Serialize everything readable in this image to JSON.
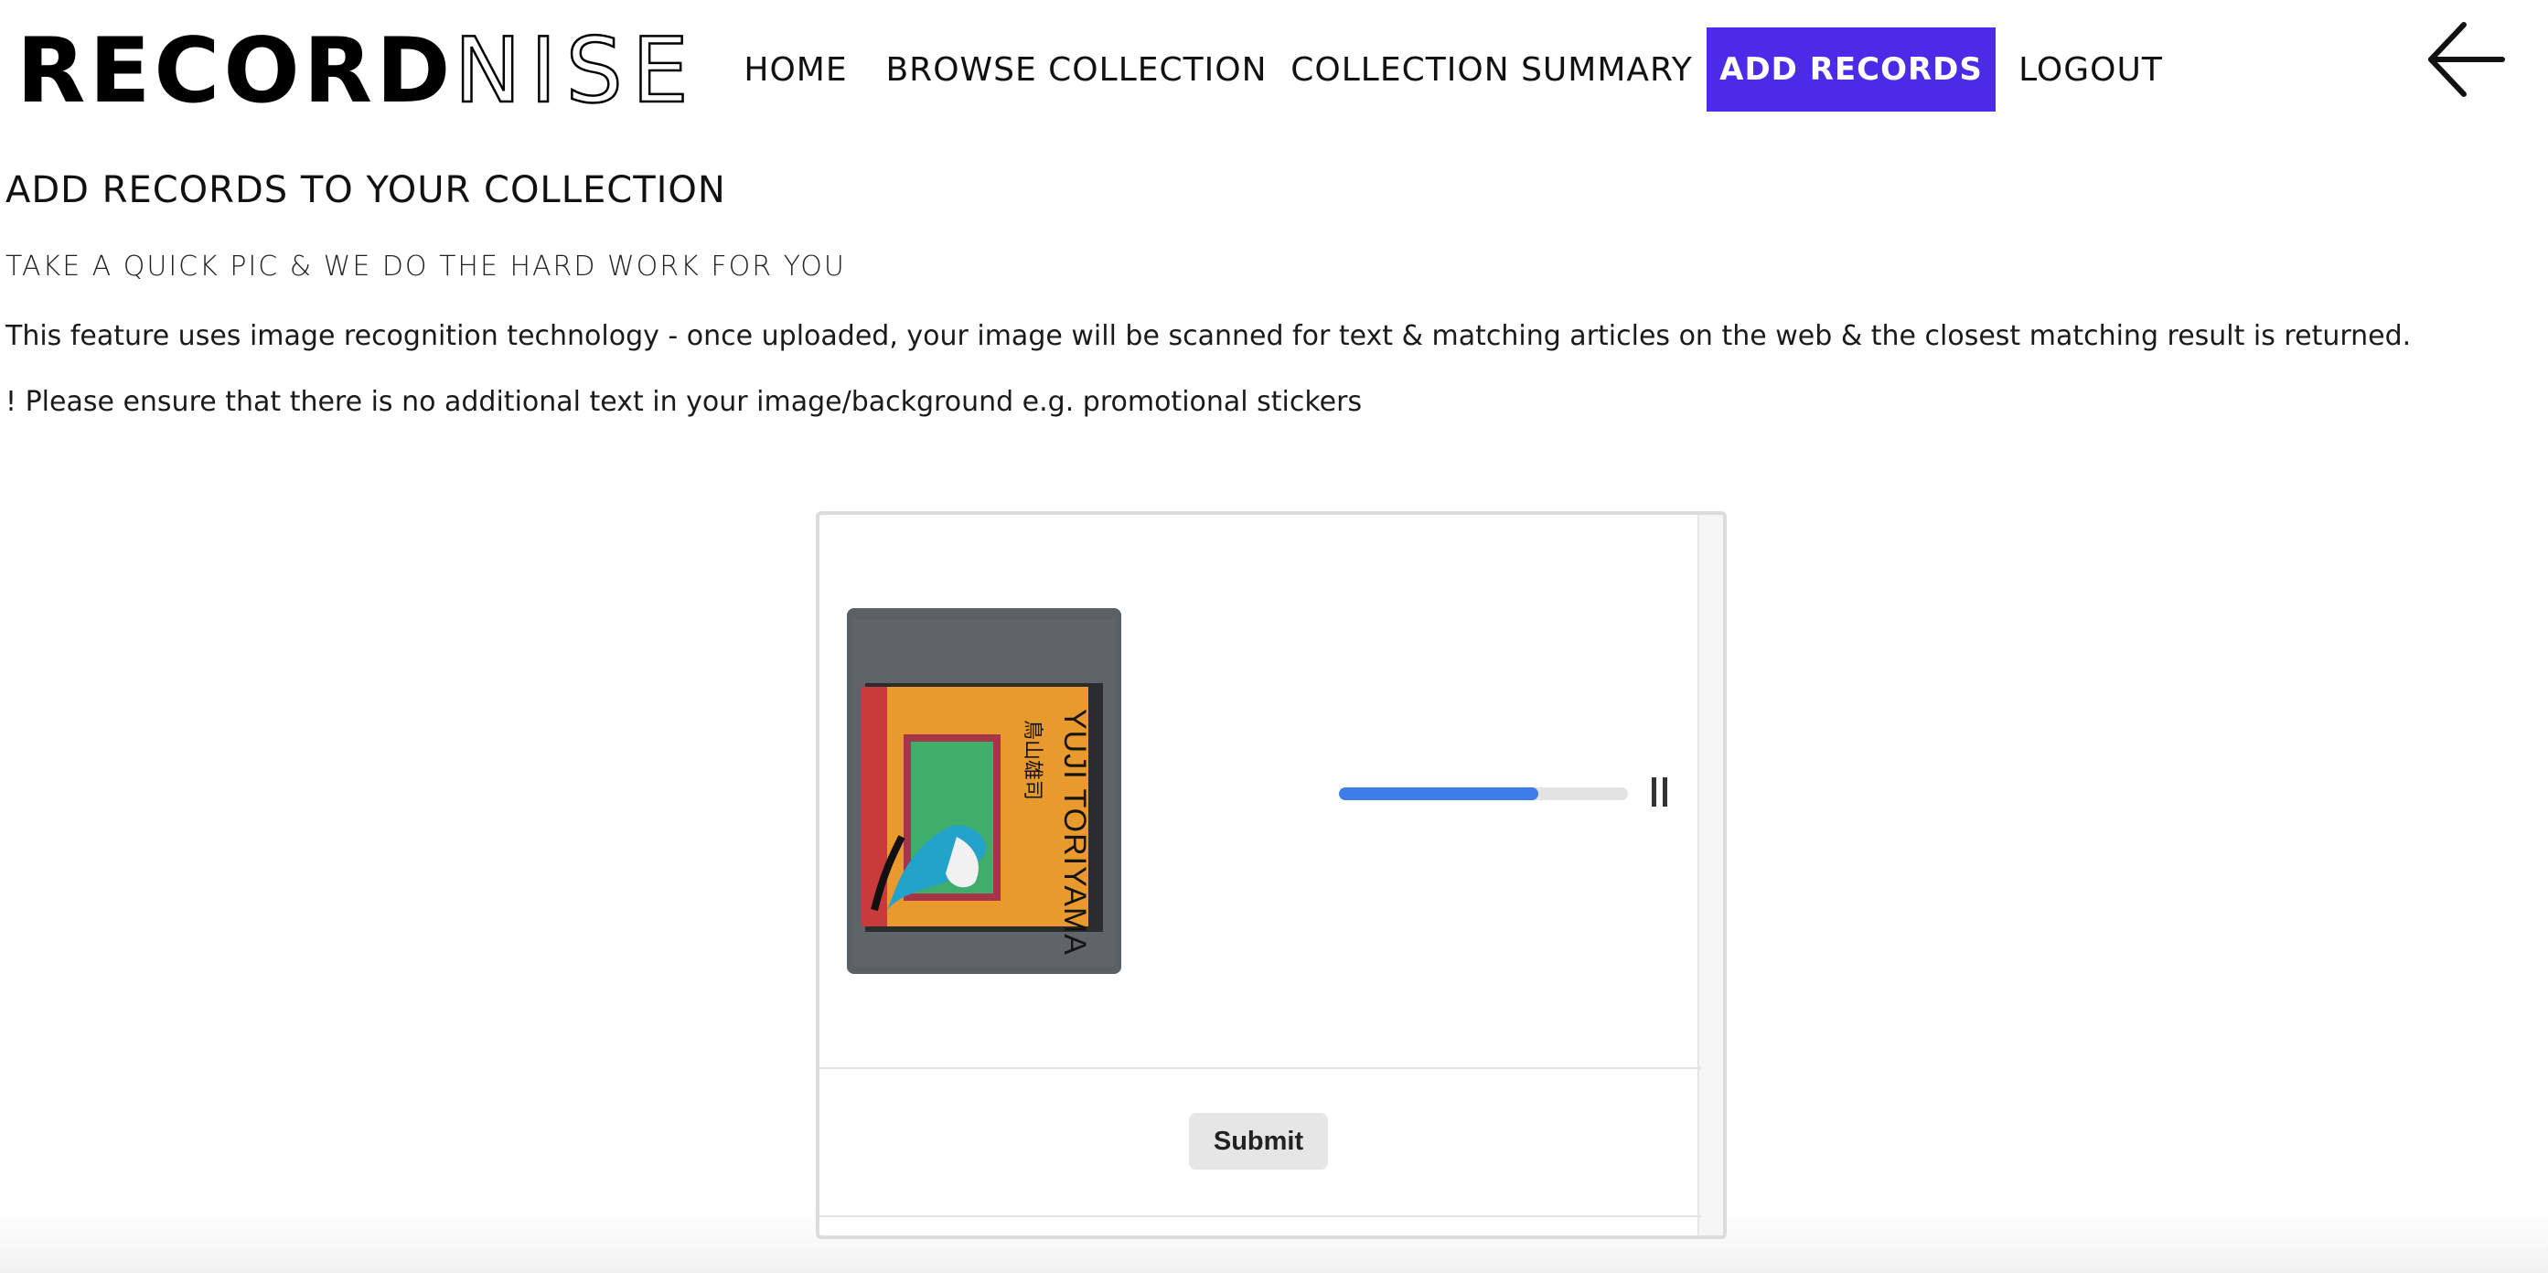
{
  "brand": {
    "logo_bold": "RECORD",
    "logo_light": "NISE"
  },
  "nav": {
    "items": [
      {
        "label": "HOME"
      },
      {
        "label": "BROWSE COLLECTION"
      },
      {
        "label": "COLLECTION SUMMARY"
      },
      {
        "label": "ADD RECORDS",
        "active": true
      },
      {
        "label": "LOGOUT"
      }
    ],
    "active_color": "#4b2be8",
    "back_icon": "arrow-left-icon"
  },
  "page": {
    "title": "ADD RECORDS TO YOUR COLLECTION",
    "subtitle": "TAKE A QUICK PIC & WE DO THE HARD WORK FOR YOU",
    "description": "This feature uses image recognition technology - once uploaded, your image will be scanned for text & matching articles on the web & the closest matching result is returned.",
    "warning": "! Please ensure that there is no additional text in your image/background e.g. promotional stickers"
  },
  "upload": {
    "thumbnail": {
      "cover_title": "YUJI TORIYAMA",
      "cover_japanese": "鳥山雄司"
    },
    "progress_percent": 69,
    "progress_color": "#3d7de8",
    "pause_icon": "pause-icon",
    "submit_label": "Submit"
  }
}
